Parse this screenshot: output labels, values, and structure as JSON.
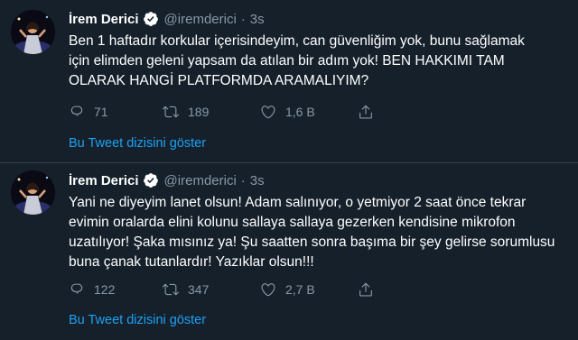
{
  "tweets": [
    {
      "name": "İrem Derici",
      "handle": "@iremderici",
      "separator": "·",
      "time": "3s",
      "lines": [
        "Ben 1 haftadır korkular içerisindeyim, can güvenliğim yok, bunu sağlamak",
        "için elimden geleni yapsam da atılan bir adım yok! BEN HAKKIMI TAM",
        "OLARAK HANGİ PLATFORMDA ARAMALIYIM?"
      ],
      "replies": "71",
      "retweets": "189",
      "likes": "1,6 B",
      "thread_link": "Bu Tweet dizisini göster"
    },
    {
      "name": "İrem Derici",
      "handle": "@iremderici",
      "separator": "·",
      "time": "3s",
      "lines": [
        "Yani ne diyeyim lanet olsun! Adam salınıyor, o yetmiyor 2 saat önce tekrar",
        "evimin oralarda elini kolunu sallaya sallaya gezerken kendisine mikrofon",
        "uzatılıyor! Şaka mısınız ya! Şu saatten sonra başıma bir şey gelirse sorumlusu",
        "buna çanak tutanlardır! Yazıklar olsun!!!"
      ],
      "replies": "122",
      "retweets": "347",
      "likes": "2,7 B",
      "thread_link": "Bu Tweet dizisini göster"
    }
  ],
  "icons": {
    "verified": "verified-badge-icon",
    "reply": "reply-icon",
    "retweet": "retweet-icon",
    "like": "heart-icon",
    "share": "share-icon"
  },
  "colors": {
    "background": "#15202b",
    "divider": "#38444d",
    "muted": "#8899a6",
    "accent": "#1da1f2",
    "text": "#ffffff"
  }
}
